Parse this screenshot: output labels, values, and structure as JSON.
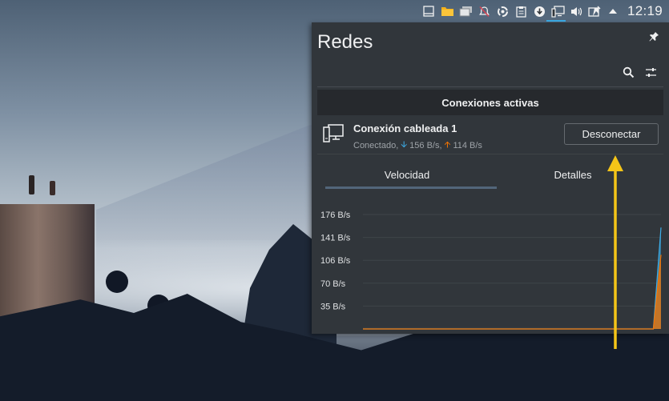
{
  "panel": {
    "clock": "12:19",
    "tray_icons": [
      "window-icon",
      "folder-icon",
      "stacked-windows-icon",
      "notifications-off-icon",
      "update-icon",
      "clipboard-icon",
      "download-icon",
      "network-wired-icon",
      "volume-icon",
      "screenshot-icon",
      "caret-up-icon"
    ]
  },
  "popup": {
    "title": "Redes",
    "active_header": "Conexiones activas",
    "connection": {
      "name": "Conexión cableada 1",
      "status": "Conectado,",
      "down": "156 B/s,",
      "up": "114 B/s",
      "button": "Desconectar"
    },
    "tabs": [
      {
        "label": "Velocidad",
        "selected": true
      },
      {
        "label": "Detalles",
        "selected": false
      }
    ]
  },
  "chart_data": {
    "type": "line",
    "y_ticks": [
      "176 B/s",
      "141 B/s",
      "106 B/s",
      "70 B/s",
      "35 B/s"
    ],
    "ylim": [
      0,
      176
    ],
    "series": [
      {
        "values": [
          0,
          0,
          0,
          0,
          0,
          0,
          0,
          0,
          0,
          0,
          0,
          0,
          0,
          0,
          0,
          0,
          0,
          0,
          0,
          0,
          0,
          0,
          0,
          0,
          0,
          0,
          0,
          0,
          0,
          0,
          0,
          0,
          0,
          0,
          0,
          0,
          0,
          0,
          0,
          156
        ]
      },
      {
        "values": [
          0,
          0,
          0,
          0,
          0,
          0,
          0,
          0,
          0,
          0,
          0,
          0,
          0,
          0,
          0,
          0,
          0,
          0,
          0,
          0,
          0,
          0,
          0,
          0,
          0,
          0,
          0,
          0,
          0,
          0,
          0,
          0,
          0,
          0,
          0,
          0,
          0,
          0,
          0,
          114
        ]
      }
    ],
    "colors": [
      "#3daee9",
      "#f67400"
    ]
  },
  "colors": {
    "accent": "#3daee9",
    "annotation": "#f5c518"
  }
}
